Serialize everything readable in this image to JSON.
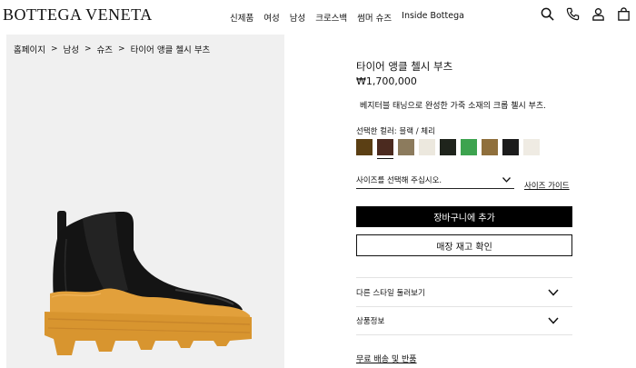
{
  "header": {
    "logo": "BOTTEGA VENETA",
    "nav": [
      "신제품",
      "여성",
      "남성",
      "크로스백",
      "썸머 슈즈",
      "Inside Bottega"
    ],
    "icons": [
      "search-icon",
      "phone-icon",
      "account-icon",
      "bag-icon"
    ]
  },
  "breadcrumb": {
    "items": [
      "홈페이지",
      "남성",
      "슈즈",
      "타이어 앵클 첼시 부츠"
    ],
    "separator": ">"
  },
  "product": {
    "name": "타이어 앵클 첼시 부츠",
    "price": "₩1,700,000",
    "description": "베지터블 태닝으로 완성한 가죽 소재의 크롭 첼시 부츠.",
    "color_label": "선택한 컬러: 블랙 / 체리",
    "swatches": [
      "#5b3f14",
      "#4b2a1f",
      "#8c7b5d",
      "#ece8de",
      "#1f241c",
      "#3da34f",
      "#8f6f3c",
      "#1c1c1c",
      "#efebe3"
    ],
    "selected_swatch": 1,
    "size_placeholder": "사이즈를 선택해 주십시오.",
    "size_guide": "사이즈 가이드",
    "add_to_cart": "장바구니에 추가",
    "check_store": "매장 재고 확인",
    "accordion": [
      "다른 스타일 둘러보기",
      "상품정보"
    ],
    "shipping": "무료 배송 및 반품"
  },
  "colors": {
    "sole": "#e2a03b",
    "leather": "#121212",
    "panel_bg": "#f0f0f0"
  }
}
